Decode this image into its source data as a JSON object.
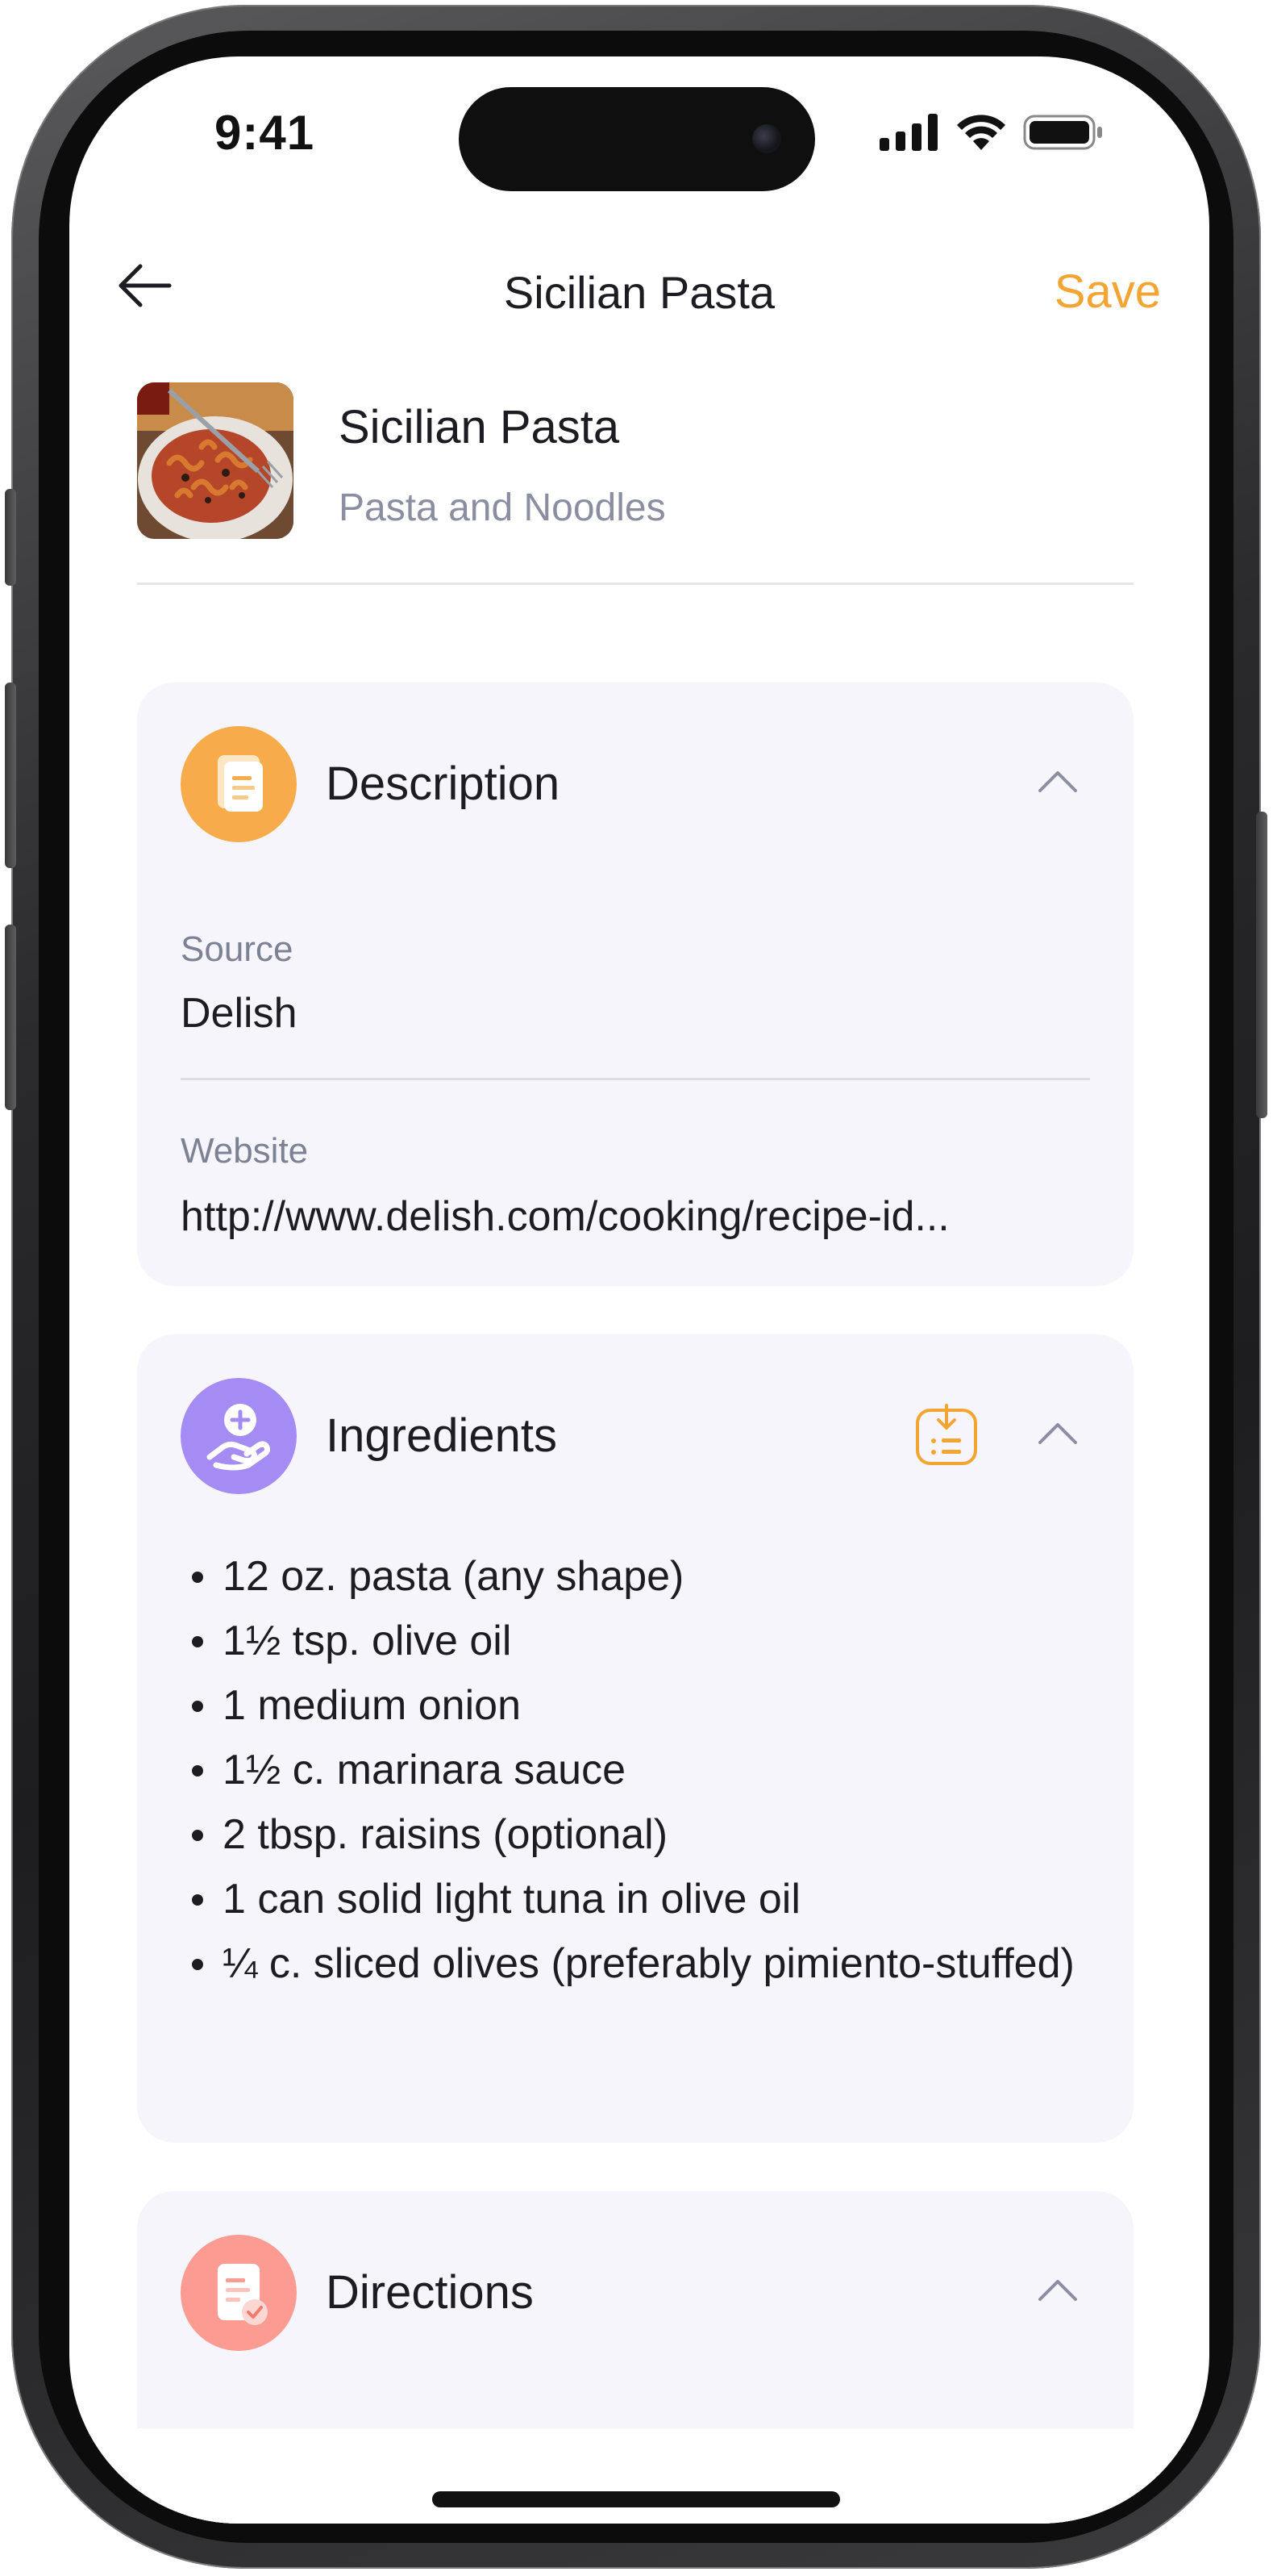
{
  "status_bar": {
    "time": "9:41"
  },
  "nav": {
    "title": "Sicilian Pasta",
    "save_label": "Save"
  },
  "recipe": {
    "name": "Sicilian Pasta",
    "category": "Pasta and Noodles"
  },
  "description": {
    "title": "Description",
    "source_label": "Source",
    "source_value": "Delish",
    "website_label": "Website",
    "website_value": "http://www.delish.com/cooking/recipe-id..."
  },
  "ingredients": {
    "title": "Ingredients",
    "items": [
      "12 oz. pasta (any shape)",
      "1½ tsp. olive oil",
      "1 medium onion",
      "1½ c. marinara sauce",
      "2 tbsp. raisins (optional)",
      "1 can solid light tuna in olive oil",
      "¼ c. sliced olives (preferably pimiento-stuffed)"
    ]
  },
  "directions": {
    "title": "Directions"
  },
  "colors": {
    "accent": "#f3a533",
    "description_icon_bg": "#f7ab4a",
    "ingredients_icon_bg": "#a58cf5",
    "directions_icon_bg": "#fb9b92",
    "card_bg": "#f5f5fb"
  },
  "icons": {
    "back": "arrow-left-icon",
    "description": "document-icon",
    "ingredients": "hand-plus-icon",
    "import": "import-list-icon",
    "directions": "document-check-icon",
    "chevron": "chevron-up-icon"
  }
}
